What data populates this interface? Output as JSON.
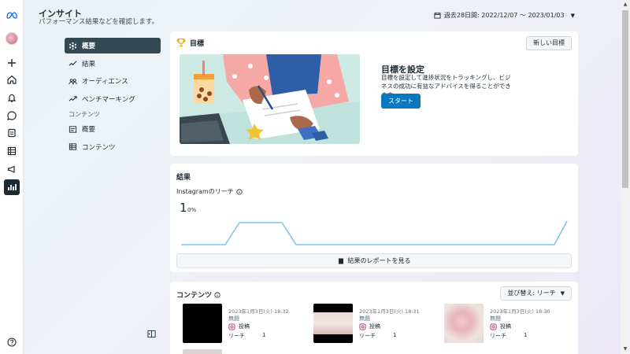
{
  "header": {
    "title": "インサイト",
    "subtitle": "パフォーマンス結果などを確認します。",
    "date_range": "過去28日間: 2022/12/07 ～ 2023/01/03"
  },
  "rail": {
    "icons": [
      "meta-logo-icon",
      "avatar",
      "plus-icon",
      "home-icon",
      "bell-icon",
      "chat-icon",
      "pages-icon",
      "grid-icon",
      "megaphone-icon",
      "bar-chart-icon",
      "help-icon"
    ]
  },
  "nav": {
    "items": [
      {
        "label": "概要",
        "icon": "overview-icon",
        "active": true
      },
      {
        "label": "結果",
        "icon": "trend-icon"
      },
      {
        "label": "オーディエンス",
        "icon": "audience-icon"
      },
      {
        "label": "ベンチマーキング",
        "icon": "benchmark-icon"
      }
    ],
    "section_label": "コンテンツ",
    "sub_items": [
      {
        "label": "概要",
        "icon": "content-overview-icon"
      },
      {
        "label": "コンテンツ",
        "icon": "table-icon"
      }
    ]
  },
  "goal": {
    "title": "目標",
    "new_goal_button": "新しい目標",
    "heading": "目標を設定",
    "description": "目標を設定して進捗状況をトラッキングし、ビジネスの成功に有益なアドバイスを得ることができます。",
    "start_button": "スタート"
  },
  "results": {
    "title": "結果",
    "reach_label": "Instagramのリーチ",
    "reach_value": "1",
    "reach_change": "0%",
    "report_button": "結果のレポートを見る"
  },
  "content": {
    "title": "コンテンツ",
    "sort_label": "並び替え: リーチ",
    "posts": [
      {
        "date": "2023年1月3日(火) 18:32",
        "caption": "無題",
        "type": "投稿",
        "reach_label": "リーチ",
        "reach": "1"
      },
      {
        "date": "2023年1月3日(火) 18:31",
        "caption": "無題",
        "type": "投稿",
        "reach_label": "リーチ",
        "reach": "1"
      },
      {
        "date": "2023年1月3日(火) 18:30",
        "caption": "無題",
        "type": "投稿",
        "reach_label": "リーチ",
        "reach": "1"
      }
    ]
  },
  "colors": {
    "accent": "#0a78be",
    "active_nav": "#344854",
    "sparkline": "#7cc4f0"
  }
}
